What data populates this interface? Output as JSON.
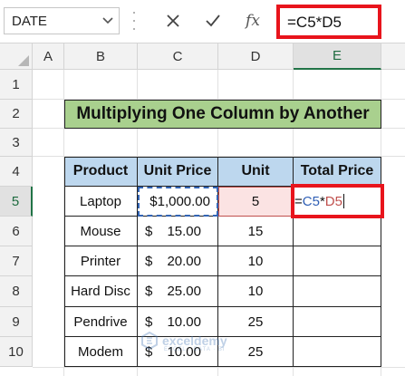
{
  "name_box": {
    "value": "DATE"
  },
  "formula_bar": {
    "cancel_icon": "close-icon",
    "enter_icon": "check-icon",
    "fx_label": "fx",
    "formula": "=C5*D5"
  },
  "columns": [
    "A",
    "B",
    "C",
    "D",
    "E"
  ],
  "selected_column": "E",
  "rows": [
    "1",
    "2",
    "3",
    "4",
    "5",
    "6",
    "7",
    "8",
    "9",
    "10"
  ],
  "selected_row": "5",
  "title": "Multiplying One Column by Another",
  "table": {
    "headers": [
      "Product",
      "Unit Price",
      "Unit",
      "Total Price"
    ],
    "rows": [
      {
        "product": "Laptop",
        "currency": "",
        "price": "$1,000.00",
        "unit": "5"
      },
      {
        "product": "Mouse",
        "currency": "$",
        "price": "15.00",
        "unit": "15"
      },
      {
        "product": "Printer",
        "currency": "$",
        "price": "20.00",
        "unit": "10"
      },
      {
        "product": "Hard Disc",
        "currency": "$",
        "price": "25.00",
        "unit": "10"
      },
      {
        "product": "Pendrive",
        "currency": "$",
        "price": "10.00",
        "unit": "25"
      },
      {
        "product": "Modem",
        "currency": "$",
        "price": "10.00",
        "unit": "25"
      }
    ]
  },
  "editing_cell": {
    "eq": "=",
    "ref1": "C5",
    "op": "*",
    "ref2": "D5"
  },
  "watermark": {
    "name": "exceldemy",
    "tagline": "EXCEL · DATA · BI"
  },
  "colors": {
    "title_fill": "#a9d08e",
    "header_fill": "#bdd7ee",
    "highlight_red": "#e8141c",
    "ref_blue": "#2f5fb5",
    "ref_red": "#c0504d"
  }
}
